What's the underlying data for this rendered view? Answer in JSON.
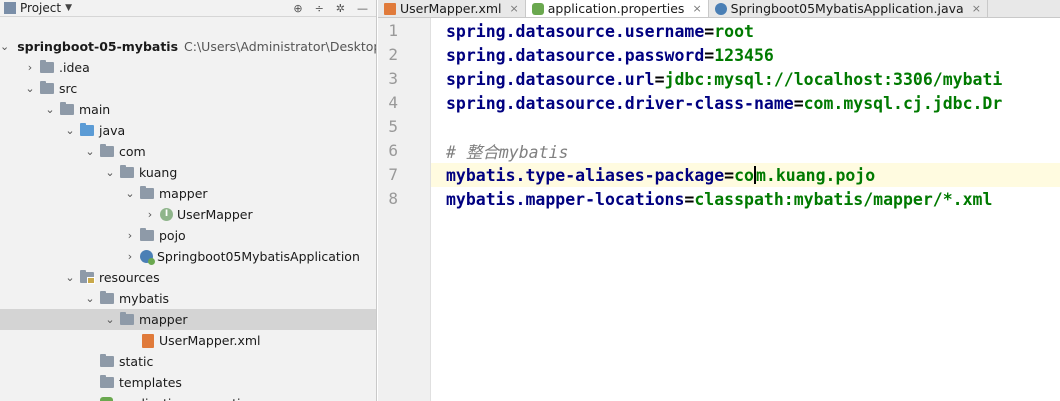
{
  "project": {
    "title": "Project",
    "tree": [
      {
        "label": "springboot-05-mybatis",
        "path": "C:\\Users\\Administrator\\Desktop\\Sh",
        "depth": 0,
        "arrow": "expanded",
        "icon": "module-icon",
        "bold": true
      },
      {
        "label": ".idea",
        "depth": 1,
        "arrow": "collapsed",
        "icon": "folder-icon"
      },
      {
        "label": "src",
        "depth": 1,
        "arrow": "expanded",
        "icon": "folder-icon"
      },
      {
        "label": "main",
        "depth": 2,
        "arrow": "expanded",
        "icon": "folder-icon"
      },
      {
        "label": "java",
        "depth": 3,
        "arrow": "expanded",
        "icon": "source-folder-icon"
      },
      {
        "label": "com",
        "depth": 4,
        "arrow": "expanded",
        "icon": "package-icon"
      },
      {
        "label": "kuang",
        "depth": 5,
        "arrow": "expanded",
        "icon": "package-icon"
      },
      {
        "label": "mapper",
        "depth": 6,
        "arrow": "expanded",
        "icon": "package-icon"
      },
      {
        "label": "UserMapper",
        "depth": 7,
        "arrow": "collapsed",
        "icon": "interface-icon"
      },
      {
        "label": "pojo",
        "depth": 6,
        "arrow": "collapsed",
        "icon": "package-icon"
      },
      {
        "label": "Springboot05MybatisApplication",
        "depth": 6,
        "arrow": "collapsed",
        "icon": "spring-class-icon"
      },
      {
        "label": "resources",
        "depth": 3,
        "arrow": "expanded",
        "icon": "resources-folder-icon"
      },
      {
        "label": "mybatis",
        "depth": 4,
        "arrow": "expanded",
        "icon": "folder-icon"
      },
      {
        "label": "mapper",
        "depth": 5,
        "arrow": "expanded",
        "icon": "folder-icon",
        "selected": true
      },
      {
        "label": "UserMapper.xml",
        "depth": 6,
        "arrow": "none",
        "icon": "xml-file-icon"
      },
      {
        "label": "static",
        "depth": 4,
        "arrow": "none",
        "icon": "folder-icon"
      },
      {
        "label": "templates",
        "depth": 4,
        "arrow": "none",
        "icon": "folder-icon"
      },
      {
        "label": "application.properties",
        "depth": 4,
        "arrow": "none",
        "icon": "properties-file-icon"
      }
    ]
  },
  "tabs": [
    {
      "label": "UserMapper.xml",
      "icon": "xml-file-icon",
      "active": false
    },
    {
      "label": "application.properties",
      "icon": "properties-file-icon",
      "active": true
    },
    {
      "label": "Springboot05MybatisApplication.java",
      "icon": "java-class-icon",
      "active": false
    }
  ],
  "editor": {
    "line_numbers": [
      "1",
      "2",
      "3",
      "4",
      "5",
      "6",
      "7",
      "8"
    ],
    "lines": [
      {
        "key": "spring.datasource.username",
        "eq": "=",
        "value": "root"
      },
      {
        "key": "spring.datasource.password",
        "eq": "=",
        "value": "123456"
      },
      {
        "key": "spring.datasource.url",
        "eq": "=",
        "value": "jdbc:mysql://localhost:3306/mybati"
      },
      {
        "key": "spring.datasource.driver-class-name",
        "eq": "=",
        "value": "com.mysql.cj.jdbc.Dr"
      },
      {
        "key": "",
        "eq": "",
        "value": ""
      },
      {
        "comment": "# 整合mybatis"
      },
      {
        "key": "mybatis.type-aliases-package",
        "eq": "=",
        "value_before_caret": "co",
        "value_after_caret": "m.kuang.pojo",
        "current": true
      },
      {
        "key": "mybatis.mapper-locations",
        "eq": "=",
        "value": "classpath:mybatis/mapper/*.xml"
      }
    ]
  },
  "colors": {
    "key": "#000080",
    "value": "#007a00",
    "comment": "#808080",
    "current_line": "#fffbe0",
    "selection": "#d4d4d4"
  }
}
